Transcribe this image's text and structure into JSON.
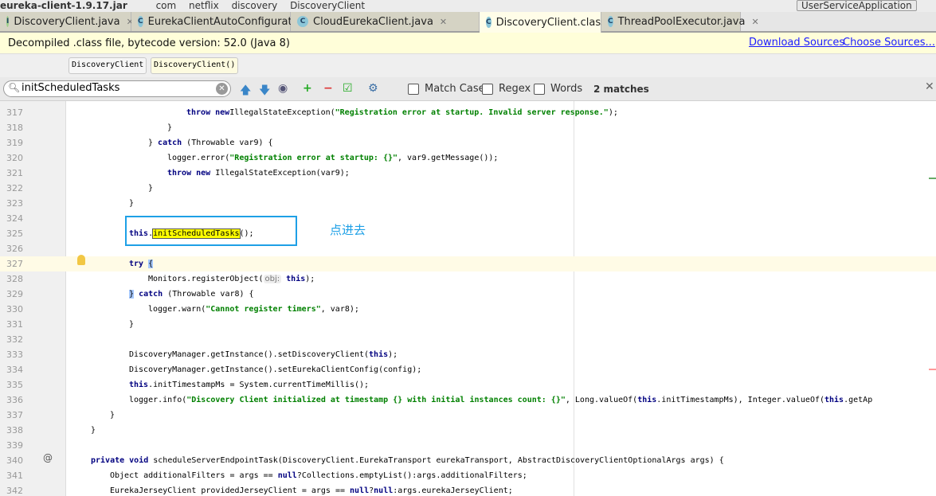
{
  "breadcrumb": [
    "eureka-client-1.9.17.jar",
    "com",
    "netflix",
    "discovery",
    "DiscoveryClient"
  ],
  "run_config": "UserServiceApplication",
  "tabs": [
    {
      "label": "DiscoveryClient.java",
      "icon": "interface-icon",
      "active": false
    },
    {
      "label": "EurekaClientAutoConfiguration.java",
      "icon": "class-icon",
      "active": false
    },
    {
      "label": "CloudEurekaClient.java",
      "icon": "class-icon",
      "active": false
    },
    {
      "label": "DiscoveryClient.class",
      "icon": "class-icon",
      "active": true
    },
    {
      "label": "ThreadPoolExecutor.java",
      "icon": "class-icon",
      "active": false
    }
  ],
  "banner": {
    "text": "Decompiled .class file, bytecode version: 52.0 (Java 8)",
    "download": "Download Sources",
    "choose": "Choose Sources..."
  },
  "nav": {
    "class": "DiscoveryClient",
    "method": "DiscoveryClient()"
  },
  "find": {
    "query": "initScheduledTasks",
    "match_case": "Match Case",
    "regex": "Regex",
    "words": "Words",
    "matches": "2 matches"
  },
  "annotation": {
    "note": "点进去",
    "color": "#1ea0e6"
  },
  "code": [
    {
      "n": 317,
      "i": 5,
      "t": [
        [
          "kw",
          "throw new"
        ],
        [
          "",
          "IllegalStateException("
        ],
        [
          "str",
          "\"Registration error at startup. Invalid server response.\""
        ],
        [
          "",
          ");"
        ]
      ]
    },
    {
      "n": 318,
      "i": 4,
      "t": [
        [
          "",
          "}"
        ]
      ]
    },
    {
      "n": 319,
      "i": 3,
      "t": [
        [
          "",
          "} "
        ],
        [
          "kw",
          "catch"
        ],
        [
          "",
          " (Throwable var9) {"
        ]
      ]
    },
    {
      "n": 320,
      "i": 4,
      "t": [
        [
          "",
          "logger.error("
        ],
        [
          "str",
          "\"Registration error at startup: {}\""
        ],
        [
          "",
          ", var9.getMessage());"
        ]
      ]
    },
    {
      "n": 321,
      "i": 4,
      "t": [
        [
          "kw",
          "throw new"
        ],
        [
          "",
          " IllegalStateException(var9);"
        ]
      ]
    },
    {
      "n": 322,
      "i": 3,
      "t": [
        [
          "",
          "}"
        ]
      ]
    },
    {
      "n": 323,
      "i": 2,
      "t": [
        [
          "",
          "}"
        ]
      ]
    },
    {
      "n": 324,
      "i": 0,
      "t": []
    },
    {
      "n": 325,
      "i": 2,
      "t": [
        [
          "kw",
          "this"
        ],
        [
          "",
          "."
        ],
        [
          "hl",
          "initScheduledTasks"
        ],
        [
          "",
          "();"
        ]
      ]
    },
    {
      "n": 326,
      "i": 0,
      "t": []
    },
    {
      "n": 327,
      "i": 2,
      "cur": true,
      "t": [
        [
          "kw",
          "try"
        ],
        [
          "",
          " "
        ],
        [
          "br",
          "{"
        ]
      ]
    },
    {
      "n": 328,
      "i": 3,
      "t": [
        [
          "",
          "Monitors.registerObject("
        ],
        [
          "hint",
          "obj:"
        ],
        [
          "",
          " "
        ],
        [
          "kw",
          "this"
        ],
        [
          "",
          ");"
        ]
      ]
    },
    {
      "n": 329,
      "i": 2,
      "t": [
        [
          "br",
          "}"
        ],
        [
          "",
          " "
        ],
        [
          "kw",
          "catch"
        ],
        [
          "",
          " (Throwable var8) {"
        ]
      ]
    },
    {
      "n": 330,
      "i": 3,
      "t": [
        [
          "",
          "logger.warn("
        ],
        [
          "str",
          "\"Cannot register timers\""
        ],
        [
          "",
          ", var8);"
        ]
      ]
    },
    {
      "n": 331,
      "i": 2,
      "t": [
        [
          "",
          "}"
        ]
      ]
    },
    {
      "n": 332,
      "i": 0,
      "t": []
    },
    {
      "n": 333,
      "i": 2,
      "t": [
        [
          "",
          "DiscoveryManager.getInstance().setDiscoveryClient("
        ],
        [
          "kw",
          "this"
        ],
        [
          "",
          ");"
        ]
      ]
    },
    {
      "n": 334,
      "i": 2,
      "t": [
        [
          "",
          "DiscoveryManager.getInstance().setEurekaClientConfig(config);"
        ]
      ]
    },
    {
      "n": 335,
      "i": 2,
      "t": [
        [
          "kw",
          "this"
        ],
        [
          "",
          ".initTimestampMs = System.currentTimeMillis();"
        ]
      ]
    },
    {
      "n": 336,
      "i": 2,
      "t": [
        [
          "",
          "logger.info("
        ],
        [
          "str",
          "\"Discovery Client initialized at timestamp {} with initial instances count: {}\""
        ],
        [
          "",
          ", Long.valueOf("
        ],
        [
          "kw",
          "this"
        ],
        [
          "",
          ".initTimestampMs), Integer.valueOf("
        ],
        [
          "kw",
          "this"
        ],
        [
          "",
          ".getAp"
        ]
      ]
    },
    {
      "n": 337,
      "i": 1,
      "t": [
        [
          "",
          "}"
        ]
      ]
    },
    {
      "n": 338,
      "i": 0,
      "t": [
        [
          "",
          "}"
        ]
      ]
    },
    {
      "n": 339,
      "i": 0,
      "t": []
    },
    {
      "n": 340,
      "i": 0,
      "t": [
        [
          "kw",
          "private void"
        ],
        [
          "",
          " scheduleServerEndpointTask(DiscoveryClient.EurekaTransport eurekaTransport, AbstractDiscoveryClientOptionalArgs args) {"
        ]
      ]
    },
    {
      "n": 341,
      "i": 1,
      "t": [
        [
          "",
          "Object additionalFilters = args == "
        ],
        [
          "kw",
          "null"
        ],
        [
          "",
          "?Collections.emptyList():args.additionalFilters;"
        ]
      ]
    },
    {
      "n": 342,
      "i": 1,
      "t": [
        [
          "",
          "EurekaJerseyClient providedJerseyClient = args == "
        ],
        [
          "kw",
          "null"
        ],
        [
          "",
          "?"
        ],
        [
          "kw",
          "null"
        ],
        [
          "",
          ":args.eurekaJerseyClient;"
        ]
      ]
    }
  ]
}
